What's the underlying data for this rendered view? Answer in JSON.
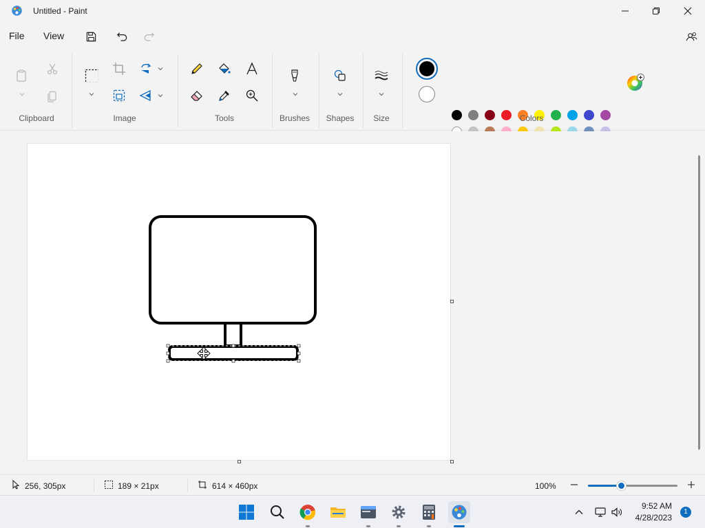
{
  "window": {
    "title": "Untitled - Paint",
    "app_icon": "paint-palette-icon"
  },
  "menu": {
    "file": "File",
    "view": "View"
  },
  "quick_access": {
    "save_icon": "save-icon",
    "undo_icon": "undo-icon",
    "redo_icon": "redo-icon",
    "account_icon": "account-icon"
  },
  "ribbon": {
    "groups": {
      "clipboard": "Clipboard",
      "image": "Image",
      "tools": "Tools",
      "brushes": "Brushes",
      "shapes": "Shapes",
      "size": "Size",
      "colors": "Colors"
    },
    "current_colors": {
      "color1": "#000000",
      "color2": "#ffffff"
    },
    "palette_row1": [
      "#000000",
      "#7f7f7f",
      "#880015",
      "#ed1c24",
      "#ff7f27",
      "#fff200",
      "#22b14c",
      "#00a2e8",
      "#3f48cc",
      "#a349a4"
    ],
    "palette_row2": [
      "#ffffff",
      "#c3c3c3",
      "#b97a57",
      "#ffaec9",
      "#ffc90e",
      "#efe4b0",
      "#b5e61d",
      "#99d9ea",
      "#7092be",
      "#c8bfe7"
    ],
    "palette_row3_empty_count": 10
  },
  "status": {
    "cursor_position": "256, 305px",
    "selection_size": "189 × 21px",
    "canvas_size": "614 × 460px",
    "zoom_level": "100%",
    "zoom_fraction": 0.38
  },
  "taskbar": {
    "time": "9:52 AM",
    "date": "4/28/2023",
    "notification_count": "1"
  }
}
